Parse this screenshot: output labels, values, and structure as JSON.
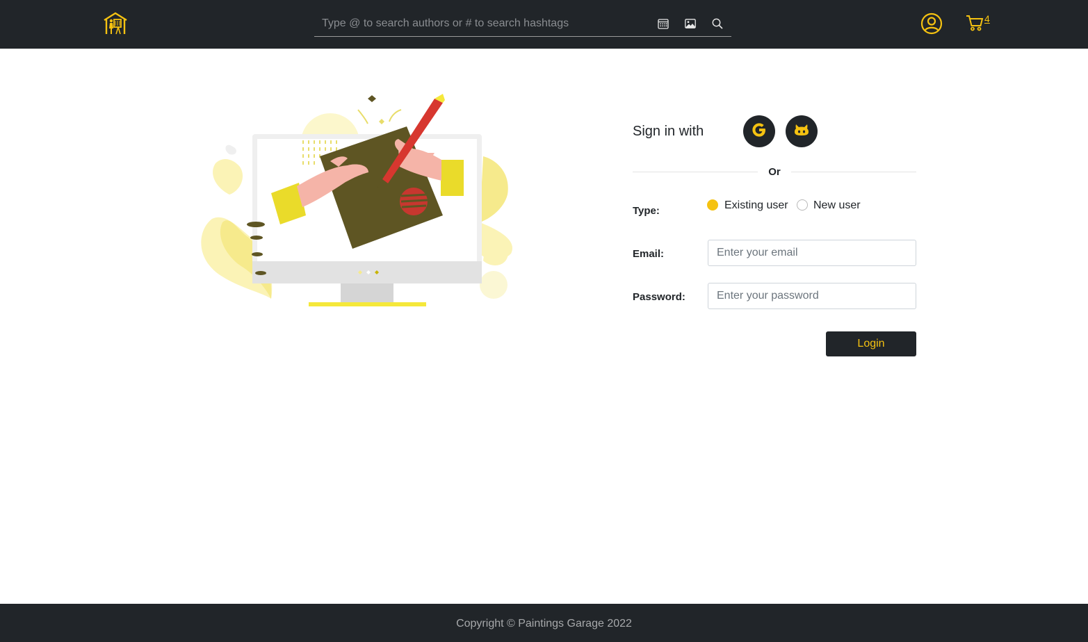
{
  "header": {
    "logo_icon": "gallery-house-icon",
    "search": {
      "placeholder": "Type @ to search authors or # to search hashtags",
      "value": "",
      "buttons": [
        "calendar-icon",
        "image-icon",
        "search-icon"
      ]
    },
    "user_icon": "user-circle-icon",
    "cart": {
      "icon": "cart-icon",
      "count": "4"
    },
    "accent_color": "#f5c211",
    "background_color": "#212529"
  },
  "signin": {
    "sign_in_with_label": "Sign in with",
    "providers": [
      "google-icon",
      "github-icon"
    ],
    "or_label": "Or",
    "type_label": "Type:",
    "type_options": [
      {
        "label": "Existing user",
        "selected": true
      },
      {
        "label": "New user",
        "selected": false
      }
    ],
    "email_label": "Email:",
    "email_placeholder": "Enter your email",
    "email_value": "",
    "password_label": "Password:",
    "password_placeholder": "Enter your password",
    "password_value": "",
    "login_label": "Login"
  },
  "footer": {
    "copyright": "Copyright © Paintings Garage 2022"
  }
}
